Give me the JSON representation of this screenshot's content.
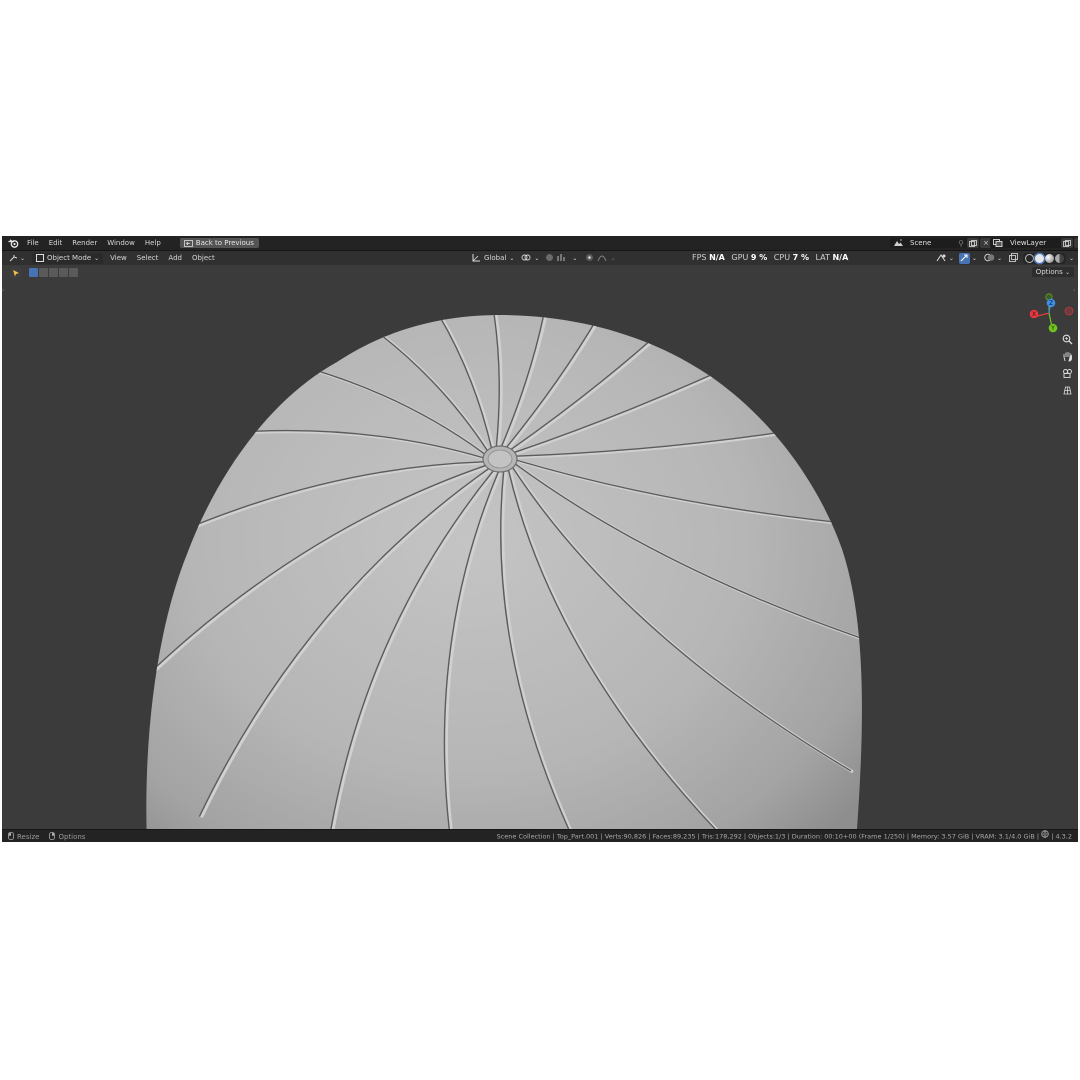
{
  "topbar": {
    "menus": [
      "File",
      "Edit",
      "Render",
      "Window",
      "Help"
    ],
    "back_label": "Back to Previous",
    "scene": "Scene",
    "view_layer": "ViewLayer"
  },
  "header": {
    "mode": "Object Mode",
    "menus": [
      "View",
      "Select",
      "Add",
      "Object"
    ],
    "transform_orientation": "Global",
    "stats": {
      "fps_label": "FPS",
      "fps": "N/A",
      "gpu_label": "GPU",
      "gpu": "9 %",
      "cpu_label": "CPU",
      "cpu": "7 %",
      "lat_label": "LAT",
      "lat": "N/A"
    }
  },
  "toolrow": {
    "options_label": "Options"
  },
  "gizmo": {
    "x": "X",
    "y": "Y",
    "z": "Z"
  },
  "statusbar": {
    "resize_label": "Resize",
    "options_label": "Options",
    "info": "Scene Collection | Top_Part.001 | Verts:90,826 | Faces:89,235 | Tris:178,292 | Objects:1/3 | Duration: 00:10+00 (Frame 1/250) | Memory: 3.57 GiB | VRAM: 3.1/4.0 GiB | ",
    "version": "4.3.2"
  },
  "colors": {
    "accent": "#4772b3",
    "axis_x": "#e8393f",
    "axis_y": "#72c41e",
    "axis_z": "#3f8ee8"
  }
}
